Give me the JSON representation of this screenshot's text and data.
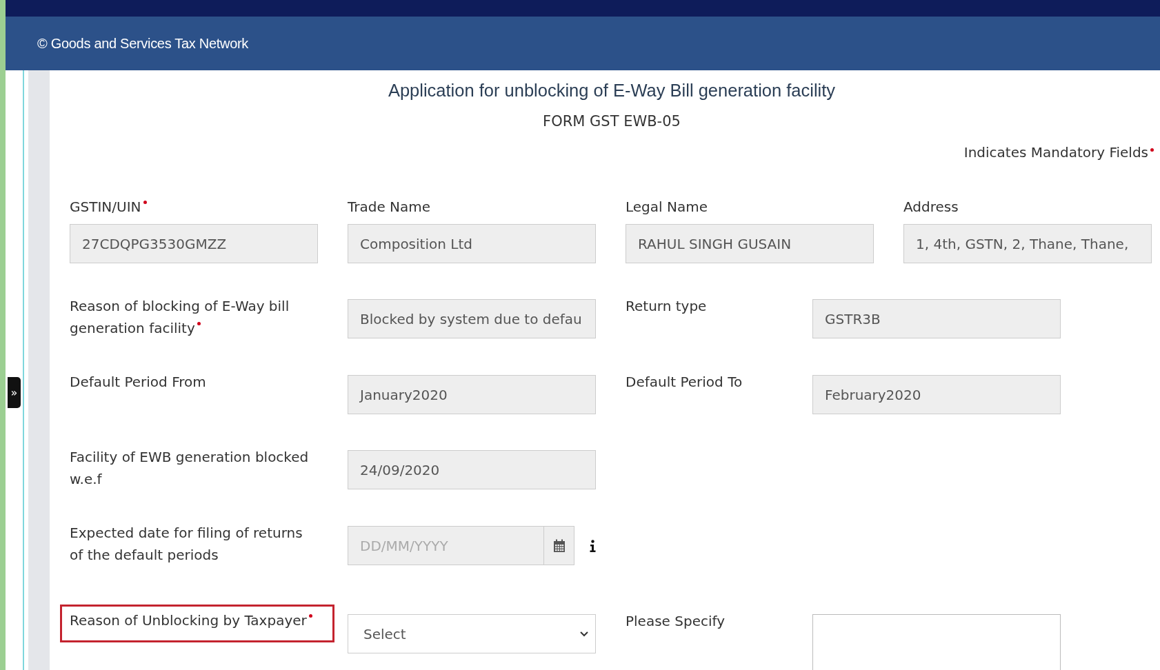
{
  "header": {
    "copyright": "© Goods and Services Tax Network"
  },
  "sidebar_toggle": "»",
  "title": "Application for unblocking of E-Way Bill generation facility",
  "subtitle": "FORM GST EWB-05",
  "mandatory_note": {
    "text": "Indicates Mandatory Fields",
    "required": true
  },
  "top_fields": [
    {
      "label": "GSTIN/UIN",
      "required": true,
      "kind": "text",
      "value": "27CDQPG3530GMZZ"
    },
    {
      "label": "Trade Name",
      "required": false,
      "kind": "text",
      "value": "Composition Ltd"
    },
    {
      "label": "Legal Name",
      "required": false,
      "kind": "text",
      "value": "RAHUL SINGH GUSAIN"
    },
    {
      "label": "Address",
      "required": false,
      "kind": "text",
      "value": "1, 4th, GSTN, 2, Thane, Thane,"
    }
  ],
  "rows": [
    {
      "left": {
        "label": "Reason of blocking of E-Way bill generation facility",
        "required": true,
        "highlighted": false,
        "kind": "text",
        "value": "Blocked by system due to defau"
      },
      "right": {
        "label": "Return type",
        "required": false,
        "kind": "text",
        "value": "GSTR3B"
      }
    },
    {
      "left": {
        "label": "Default Period From",
        "required": false,
        "highlighted": false,
        "kind": "text",
        "value": "January2020"
      },
      "right": {
        "label": "Default Period To",
        "required": false,
        "kind": "text",
        "value": "February2020"
      }
    },
    {
      "left": {
        "label": "Facility of EWB generation blocked w.e.f",
        "required": false,
        "highlighted": false,
        "kind": "text",
        "value": "24/09/2020"
      }
    },
    {
      "left": {
        "label": "Expected date for filing of returns of the default periods",
        "required": false,
        "highlighted": false,
        "kind": "date",
        "placeholder": "DD/MM/YYYY",
        "info": true
      }
    },
    {
      "left": {
        "label": "Reason of Unblocking by Taxpayer",
        "required": true,
        "highlighted": true,
        "kind": "select",
        "value": "Select"
      },
      "right": {
        "label": "Please Specify",
        "required": false,
        "kind": "textarea"
      }
    }
  ]
}
